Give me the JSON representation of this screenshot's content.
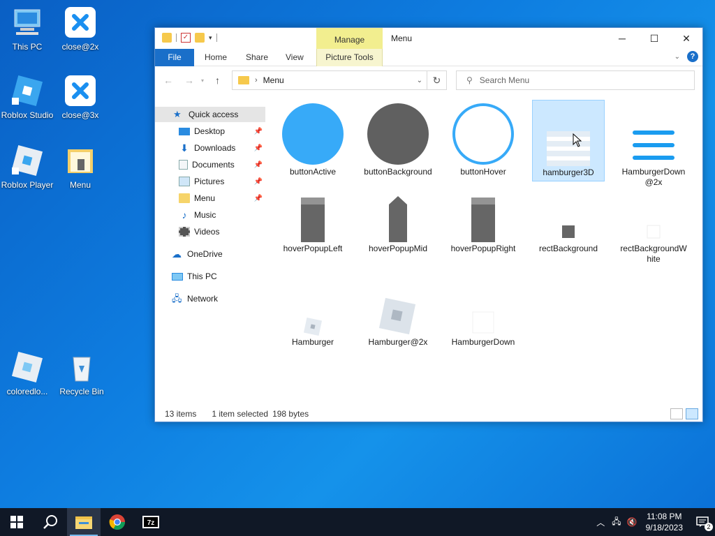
{
  "desktop": {
    "icons": [
      {
        "label": "This PC",
        "icon": "computer-icon"
      },
      {
        "label": "close@2x",
        "icon": "close-icon"
      },
      {
        "label": "Roblox Studio",
        "icon": "roblox-studio-icon"
      },
      {
        "label": "close@3x",
        "icon": "close-icon"
      },
      {
        "label": "Roblox Player",
        "icon": "roblox-player-icon"
      },
      {
        "label": "Menu",
        "icon": "folder-icon"
      },
      {
        "label": "coloredlo...",
        "icon": "roblox-logo-icon"
      },
      {
        "label": "Recycle Bin",
        "icon": "recycle-bin-icon"
      }
    ]
  },
  "window": {
    "title": "Menu",
    "manage_tab": "Manage",
    "controls": {
      "minimize": "─",
      "maximize": "☐",
      "close": "✕"
    },
    "ribbon_tabs": {
      "file": "File",
      "home": "Home",
      "share": "Share",
      "view": "View",
      "picture_tools": "Picture Tools"
    },
    "help": "?",
    "address": {
      "path": "Menu"
    },
    "search": {
      "placeholder": "Search Menu"
    },
    "nav_pane": [
      {
        "label": "Quick access",
        "icon": "star-icon",
        "pinned": false
      },
      {
        "label": "Desktop",
        "icon": "desktop-icon",
        "pinned": true
      },
      {
        "label": "Downloads",
        "icon": "download-icon",
        "pinned": true
      },
      {
        "label": "Documents",
        "icon": "documents-icon",
        "pinned": true
      },
      {
        "label": "Pictures",
        "icon": "pictures-icon",
        "pinned": true
      },
      {
        "label": "Menu",
        "icon": "folder-icon",
        "pinned": true
      },
      {
        "label": "Music",
        "icon": "music-icon",
        "pinned": false
      },
      {
        "label": "Videos",
        "icon": "videos-icon",
        "pinned": false
      },
      {
        "label": "OneDrive",
        "icon": "cloud-icon",
        "pinned": false
      },
      {
        "label": "This PC",
        "icon": "computer-icon",
        "pinned": false
      },
      {
        "label": "Network",
        "icon": "network-icon",
        "pinned": false
      }
    ],
    "files": [
      {
        "name": "buttonActive",
        "selected": false
      },
      {
        "name": "buttonBackground",
        "selected": false
      },
      {
        "name": "buttonHover",
        "selected": false
      },
      {
        "name": "hamburger3D",
        "selected": true
      },
      {
        "name": "HamburgerDown@2x",
        "selected": false
      },
      {
        "name": "hoverPopupLeft",
        "selected": false
      },
      {
        "name": "hoverPopupMid",
        "selected": false
      },
      {
        "name": "hoverPopupRight",
        "selected": false
      },
      {
        "name": "rectBackground",
        "selected": false
      },
      {
        "name": "rectBackgroundWhite",
        "selected": false
      },
      {
        "name": "Hamburger",
        "selected": false
      },
      {
        "name": "Hamburger@2x",
        "selected": false
      },
      {
        "name": "HamburgerDown",
        "selected": false
      }
    ],
    "status": {
      "count": "13 items",
      "selection": "1 item selected",
      "size": "198 bytes"
    }
  },
  "taskbar": {
    "time": "11:08 PM",
    "date": "9/18/2023",
    "notifications": "2"
  },
  "colors": {
    "accent": "#1a6fc9",
    "selection": "#cce8ff",
    "manage": "#f2ee8f"
  }
}
